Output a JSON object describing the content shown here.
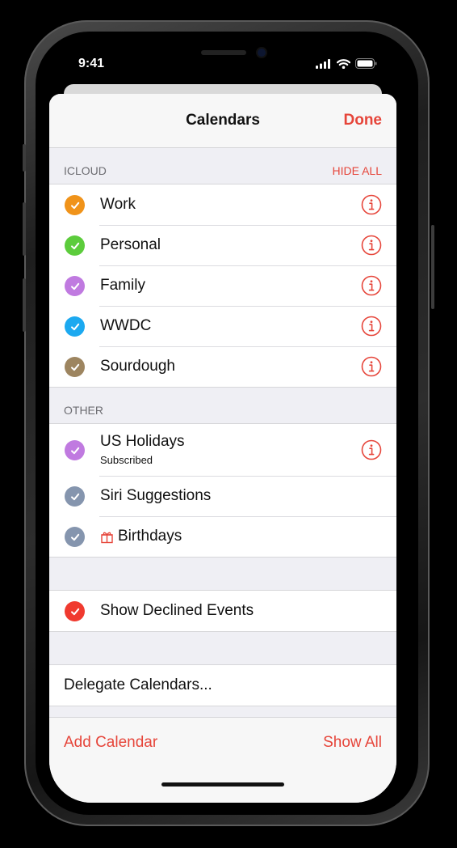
{
  "status_bar": {
    "time": "9:41"
  },
  "nav": {
    "title": "Calendars",
    "done_label": "Done"
  },
  "icloud_section": {
    "header": "ICLOUD",
    "action": "HIDE ALL",
    "items": [
      {
        "label": "Work",
        "color": "#f0931a"
      },
      {
        "label": "Personal",
        "color": "#5ccc3c"
      },
      {
        "label": "Family",
        "color": "#c07ae0"
      },
      {
        "label": "WWDC",
        "color": "#1ca9f0"
      },
      {
        "label": "Sourdough",
        "color": "#9d8560"
      }
    ]
  },
  "other_section": {
    "header": "OTHER",
    "items": [
      {
        "label": "US Holidays",
        "sublabel": "Subscribed",
        "color": "#c07ae0"
      },
      {
        "label": "Siri Suggestions",
        "color": "#8595ae"
      },
      {
        "label": "Birthdays",
        "color": "#8595ae",
        "icon": "gift-icon"
      }
    ]
  },
  "declined": {
    "label": "Show Declined Events",
    "color": "#f03a2f"
  },
  "delegate": {
    "label": "Delegate Calendars..."
  },
  "toolbar": {
    "add_label": "Add Calendar",
    "show_all_label": "Show All"
  },
  "colors": {
    "accent": "#e6453a"
  },
  "icons": {
    "info": "info-circle-icon",
    "check": "checkmark-icon",
    "gift": "gift-icon",
    "signal": "cellular-signal-icon",
    "wifi": "wifi-icon",
    "battery": "battery-icon"
  }
}
